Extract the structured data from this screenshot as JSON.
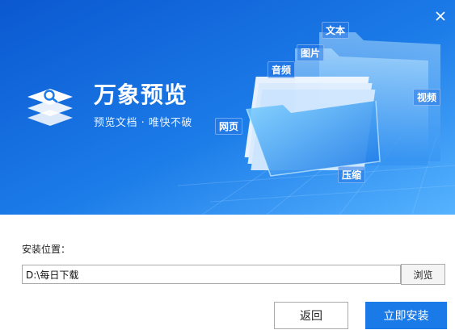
{
  "banner": {
    "title": "万象预览",
    "subtitle": "预览文档 · 唯快不破",
    "tags": {
      "text": "文本",
      "image": "图片",
      "audio": "音频",
      "video": "视频",
      "web": "网页",
      "archive": "压缩"
    }
  },
  "install": {
    "location_label": "安装位置：",
    "path_value": "D:\\每日下载",
    "browse_label": "浏览",
    "back_label": "返回",
    "install_label": "立即安装"
  },
  "colors": {
    "banner_dark": "#0d5fd6",
    "banner_light": "#2d8ff0",
    "primary_button": "#1a7be8"
  },
  "icons": [
    "close-icon",
    "app-logo-icon"
  ]
}
